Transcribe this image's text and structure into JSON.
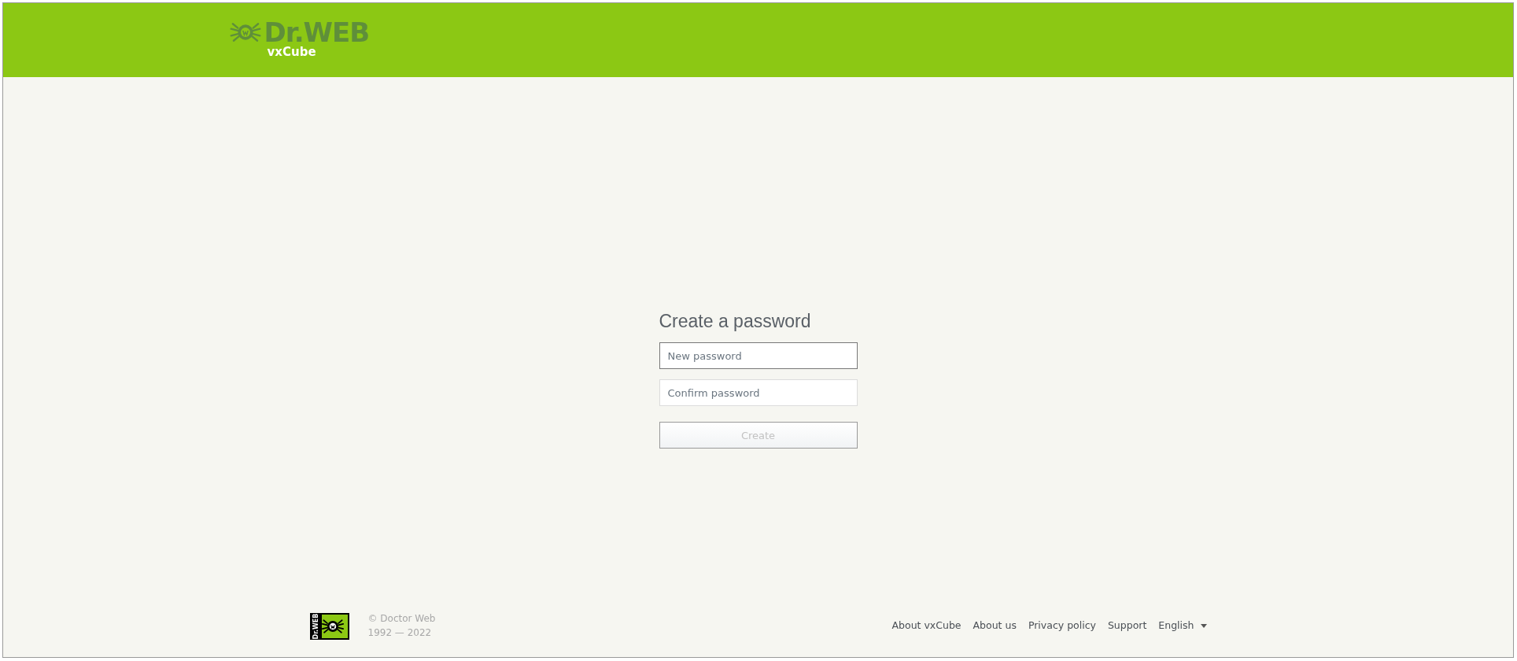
{
  "header": {
    "logo_title": "Dr.WEB",
    "logo_subtitle": "vxCube"
  },
  "form": {
    "title": "Create a password",
    "fields": [
      {
        "placeholder": "New password",
        "focused": true
      },
      {
        "placeholder": "Confirm password",
        "focused": false
      }
    ],
    "submit": {
      "label": "Create",
      "disabled": true
    }
  },
  "footer": {
    "badge_text": "Dr.WEB",
    "copyright": "© Doctor Web",
    "years": "1992 — 2022",
    "links": [
      "About vxCube",
      "About us",
      "Privacy policy",
      "Support"
    ],
    "language": "English"
  }
}
